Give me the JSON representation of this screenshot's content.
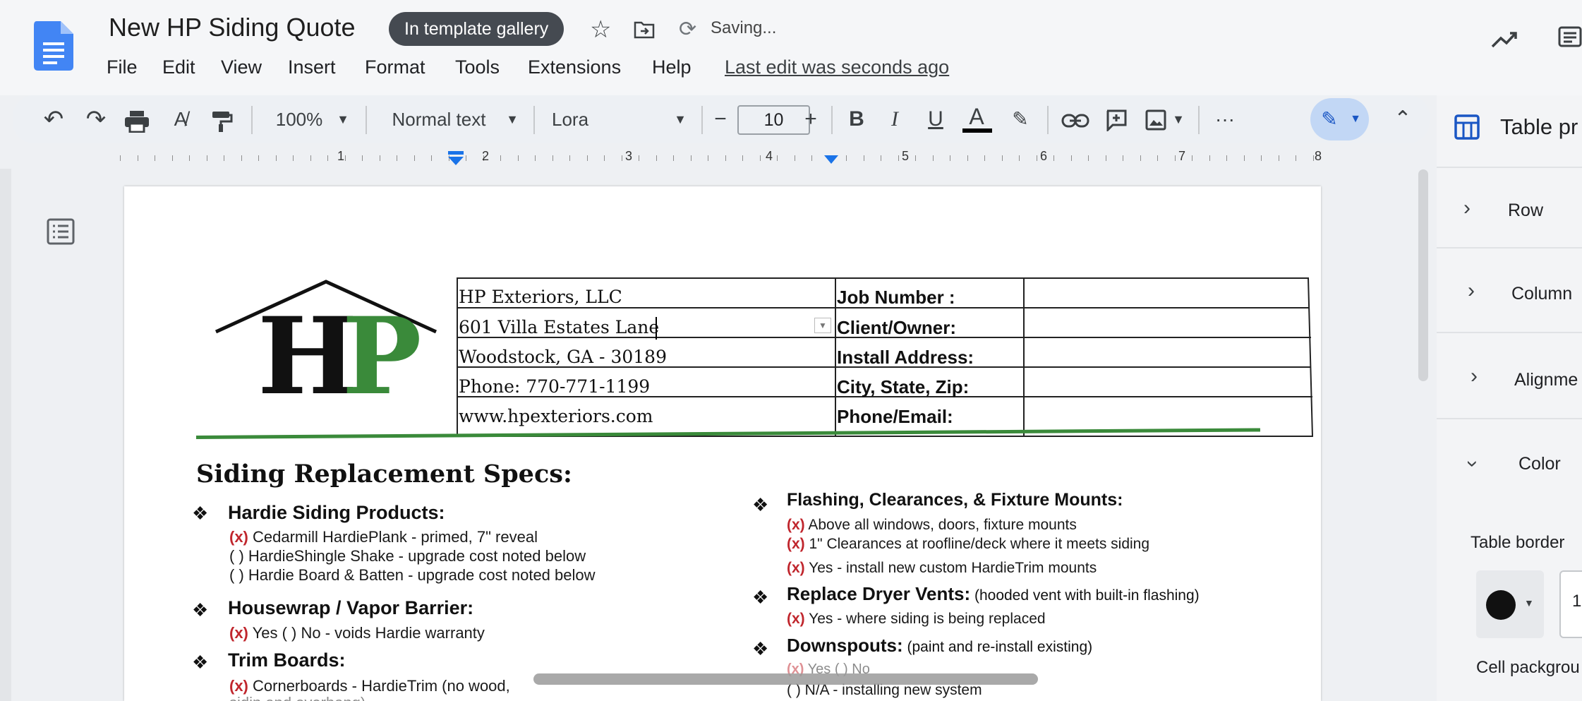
{
  "app": {
    "title": "New HP Siding Quote",
    "template_badge": "In template gallery",
    "status": "Saving...",
    "last_edit": "Last edit was seconds ago"
  },
  "menu": [
    "File",
    "Edit",
    "View",
    "Insert",
    "Format",
    "Tools",
    "Extensions",
    "Help"
  ],
  "toolbar": {
    "zoom": "100%",
    "style": "Normal text",
    "font": "Lora",
    "font_size": "10",
    "minus": "−",
    "plus": "+",
    "bold": "B",
    "italic": "I",
    "underline": "U",
    "text_color": "A",
    "more": "···"
  },
  "ruler_numbers": [
    "1",
    "2",
    "3",
    "4",
    "5",
    "6",
    "7",
    "8"
  ],
  "sidebar": {
    "title": "Table pr",
    "row": "Row",
    "column": "Column",
    "alignment": "Alignme",
    "color": "Color",
    "table_border": "Table border",
    "border_width": "1",
    "cell_background": "Cell packgrou"
  },
  "document": {
    "logo_letters": "HP",
    "table": [
      [
        "HP Exteriors, LLC",
        "Job Number :",
        ""
      ],
      [
        "601 Villa Estates Lane",
        "Client/Owner:",
        ""
      ],
      [
        "Woodstock, GA - 30189",
        "Install Address:",
        ""
      ],
      [
        "Phone: 770-771-1199",
        "City, State, Zip:",
        ""
      ],
      [
        "www.hpexteriors.com",
        "Phone/Email:",
        ""
      ]
    ],
    "heading": "Siding Replacement Specs:",
    "left_sections": [
      {
        "title": "Hardie Siding Products:",
        "items": [
          {
            "mark": "(x)",
            "text": " Cedarmill HardiePlank - primed, 7\" reveal"
          },
          {
            "mark": "( )",
            "text": " HardieShingle Shake - upgrade cost noted below"
          },
          {
            "mark": "( )",
            "text": " Hardie Board & Batten - upgrade cost noted below"
          }
        ]
      },
      {
        "title": "Housewrap / Vapor Barrier:",
        "items": [
          {
            "mark": "(x)",
            "text": " Yes  ( ) No - voids Hardie warranty"
          }
        ]
      },
      {
        "title": "Trim Boards:",
        "items": [
          {
            "mark": "(x)",
            "text": " Cornerboards - HardieTrim (no wood,"
          },
          {
            "mark": "",
            "text": "                                    sidin and overhang)"
          }
        ]
      }
    ],
    "right_sections": [
      {
        "title": "Flashing, Clearances, & Fixture Mounts:",
        "note": "",
        "items": [
          {
            "mark": "(x)",
            "text": " Above all windows, doors, fixture mounts"
          },
          {
            "mark": "(x)",
            "text": " 1\" Clearances at roofline/deck where it meets siding"
          },
          {
            "mark": "(x)",
            "text": " Yes - install new custom HardieTrim mounts"
          }
        ]
      },
      {
        "title": "Replace Dryer Vents:",
        "note": " (hooded vent with built-in flashing)",
        "items": [
          {
            "mark": "(x)",
            "text": " Yes - where siding is being replaced"
          }
        ]
      },
      {
        "title": "Downspouts:",
        "note": " (paint and re-install existing)",
        "items": [
          {
            "mark": "(x)",
            "text": " Yes  ( ) No"
          },
          {
            "mark": "( )",
            "text": " N/A - installing new system"
          }
        ]
      }
    ]
  },
  "colors": {
    "accent_green": "#3a8a3a",
    "check_red": "#c0262d",
    "badge": "#454a51",
    "docs_blue": "#4285f4"
  }
}
